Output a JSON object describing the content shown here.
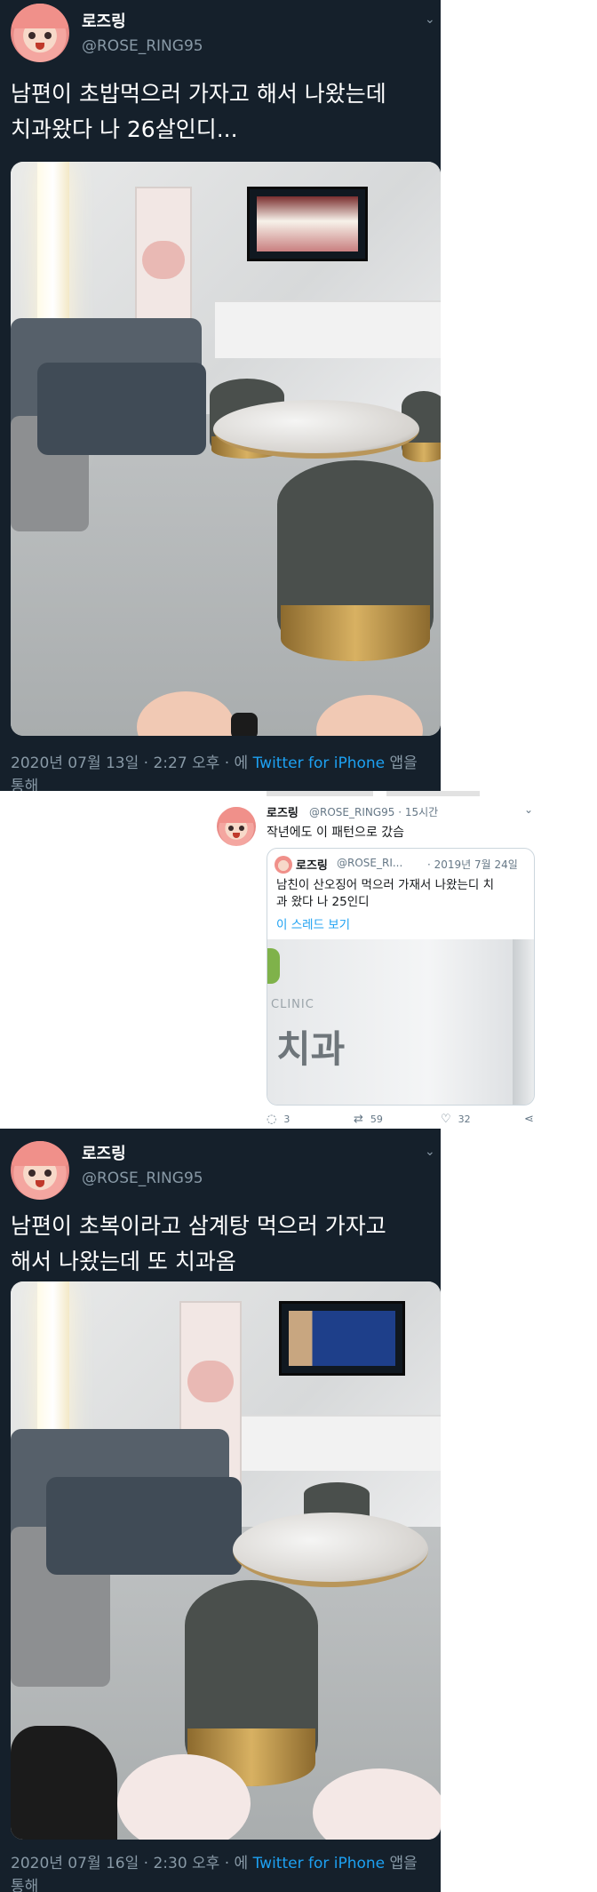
{
  "tweet1": {
    "name": "로즈링",
    "handle": "@ROSE_RING95",
    "text_line1": "남편이 초밥먹으러 가자고 해서 나왔는데",
    "text_line2": "치과왔다 나 26살인디...",
    "meta_time": "2020년 07월 13일 · 2:27 오후 · 에 ",
    "meta_app": "Twitter for iPhone",
    "meta_suffix": " 앱을",
    "meta_line2": "통해"
  },
  "tweet2": {
    "name": "로즈링",
    "handle": "@ROSE_RING95 · 15시간",
    "text": "작년에도 이 패턴으로 갔슴",
    "quote": {
      "name": "로즈링",
      "handle": "@ROSE_RI...",
      "date": "· 2019년 7월 24일",
      "text_line1": "남친이 산오징어 먹으러 가재서 나왔는디 치",
      "text_line2": "과 왔다 나 25인디",
      "thread_link": "이 스레드 보기",
      "sign_small": "CLINIC",
      "sign_big": "치과"
    },
    "actions": {
      "replies": "3",
      "retweets": "59",
      "likes": "32"
    }
  },
  "tweet3": {
    "name": "로즈링",
    "handle": "@ROSE_RING95",
    "text_line1": "남편이 초복이라고 삼계탕 먹으러 가자고",
    "text_line2": "해서 나왔는데 또 치과옴",
    "meta_time": "2020년 07월 16일 · 2:30 오후 · 에 ",
    "meta_app": "Twitter for iPhone",
    "meta_suffix": " 앱을",
    "meta_line2": "통해"
  },
  "icons": {
    "chevron": "chevron-down-icon",
    "reply": "reply-icon",
    "retweet": "retweet-icon",
    "like": "heart-icon",
    "share": "share-icon"
  },
  "colors": {
    "dark_bg": "#15202b",
    "link_blue": "#1da1f2",
    "secondary_text": "#8899a6"
  }
}
